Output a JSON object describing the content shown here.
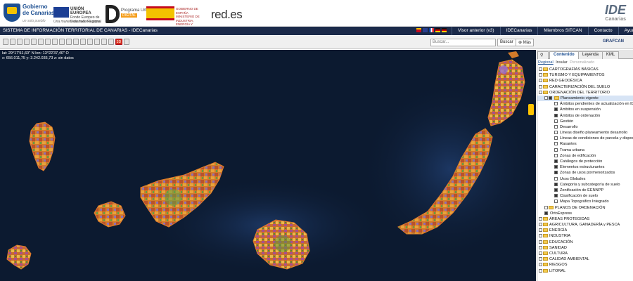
{
  "banner": {
    "gobierno": "Gobierno de Canarias",
    "gobierno_sub": "un solo pueblo",
    "eu_title": "UNIÓN EUROPEA",
    "eu_fund": "Fondo Europeo de Desarrollo Regional",
    "eu_motto": "Una manera de hacer Europa",
    "programa": "Programa Urbanismo",
    "programa_tag": "DIGITAL",
    "ministerio": "MINISTERIO DE INDUSTRIA, ENERGÍA Y TURISMO",
    "gobierno_es": "GOBIERNO DE ESPAÑA",
    "redes": "red.es",
    "ide_big": "IDE",
    "ide_small": "Canarias"
  },
  "navbar": {
    "title": "SISTEMA DE INFORMACIÓN TERRITORIAL DE CANARIAS - IDECanarias",
    "links": [
      "Visor anterior (v3)",
      "IDECanarias",
      "Miembros SITCAN",
      "Contacto",
      "Ayuda"
    ]
  },
  "toolbar": {
    "mode_3d": "3D",
    "search_placeholder": "Buscar...",
    "search_button": "Buscar",
    "more_button": "Más",
    "grafcan": "GRAFCAN"
  },
  "coords": {
    "latlon": "lat: 29°17'51,60'' N  lon: 13°22'37,40'' O",
    "xyz": "x: 656.011,75  y: 3.242.035,73  z: sin datos"
  },
  "colors": {
    "navbar": "#1b2a4a",
    "map_bg": "#0c1a30",
    "accent": "#ffc400"
  },
  "panel": {
    "tabs": [
      "Contenido",
      "Leyenda",
      "KML"
    ],
    "subtabs": [
      "Regional",
      "Insular",
      "Personalizado"
    ],
    "tree": [
      {
        "label": "CARTOGRAFÍAS BÁSICAS",
        "type": "folder",
        "level": 0
      },
      {
        "label": "TURISMO Y EQUIPAMIENTOS",
        "type": "folder",
        "level": 0
      },
      {
        "label": "RED GEODÉSICA",
        "type": "folder",
        "level": 0
      },
      {
        "label": "CARACTERIZACIÓN DEL SUELO",
        "type": "folder",
        "level": 0
      },
      {
        "label": "ORDENACIÓN DEL TERRITORIO",
        "type": "folder",
        "level": 0
      },
      {
        "label": "Planeamiento vigente",
        "type": "group",
        "level": 1,
        "checked": true,
        "selected": true
      },
      {
        "label": "Ámbitos pendientes de actualización en IDE",
        "type": "layer",
        "level": 2,
        "checked": false
      },
      {
        "label": "Ámbitos en suspensión",
        "type": "layer",
        "level": 2,
        "checked": true
      },
      {
        "label": "Ámbitos de ordenación",
        "type": "layer",
        "level": 2,
        "checked": true
      },
      {
        "label": "Gestión",
        "type": "layer",
        "level": 2,
        "checked": false
      },
      {
        "label": "Desarrollo",
        "type": "layer",
        "level": 2,
        "checked": false
      },
      {
        "label": "Líneas diseño planeamiento desarrollo",
        "type": "layer",
        "level": 2,
        "checked": false
      },
      {
        "label": "Líneas de condiciones de parcela y disposición",
        "type": "layer",
        "level": 2,
        "checked": false
      },
      {
        "label": "Rasantes",
        "type": "layer",
        "level": 2,
        "checked": false
      },
      {
        "label": "Trama urbana",
        "type": "layer",
        "level": 2,
        "checked": false
      },
      {
        "label": "Zonas de edificación",
        "type": "layer",
        "level": 2,
        "checked": false
      },
      {
        "label": "Catálogos de protección",
        "type": "layer",
        "level": 2,
        "checked": true
      },
      {
        "label": "Elementos estructurantes",
        "type": "layer",
        "level": 2,
        "checked": true
      },
      {
        "label": "Zonas de usos pormenorizados",
        "type": "layer",
        "level": 2,
        "checked": true
      },
      {
        "label": "Usos Globales",
        "type": "layer",
        "level": 2,
        "checked": false
      },
      {
        "label": "Categoría y subcategoría de suelo",
        "type": "layer",
        "level": 2,
        "checked": true
      },
      {
        "label": "Zonificación de EENNPP",
        "type": "layer",
        "level": 2,
        "checked": true
      },
      {
        "label": "Clasificación de suelo",
        "type": "layer",
        "level": 2,
        "checked": true
      },
      {
        "label": "Mapa Topográfico Integrado",
        "type": "layer",
        "level": 2,
        "checked": false
      },
      {
        "label": "PLANOS DE ORDENACIÓN",
        "type": "folder",
        "level": 1
      },
      {
        "label": "OrtoExpress",
        "type": "layer",
        "level": 1,
        "checked": true
      },
      {
        "label": "ÁREAS PROTEGIDAS",
        "type": "folder",
        "level": 0
      },
      {
        "label": "AGRICULTURA, GANADERÍA y PESCA",
        "type": "folder",
        "level": 0
      },
      {
        "label": "ENERGÍA",
        "type": "folder",
        "level": 0
      },
      {
        "label": "INDUSTRIA",
        "type": "folder",
        "level": 0
      },
      {
        "label": "EDUCACIÓN",
        "type": "folder",
        "level": 0
      },
      {
        "label": "SANIDAD",
        "type": "folder",
        "level": 0
      },
      {
        "label": "CULTURA",
        "type": "folder",
        "level": 0
      },
      {
        "label": "CALIDAD AMBIENTAL",
        "type": "folder",
        "level": 0
      },
      {
        "label": "RIESGOS",
        "type": "folder",
        "level": 0
      },
      {
        "label": "LITORAL",
        "type": "folder",
        "level": 0
      }
    ]
  }
}
